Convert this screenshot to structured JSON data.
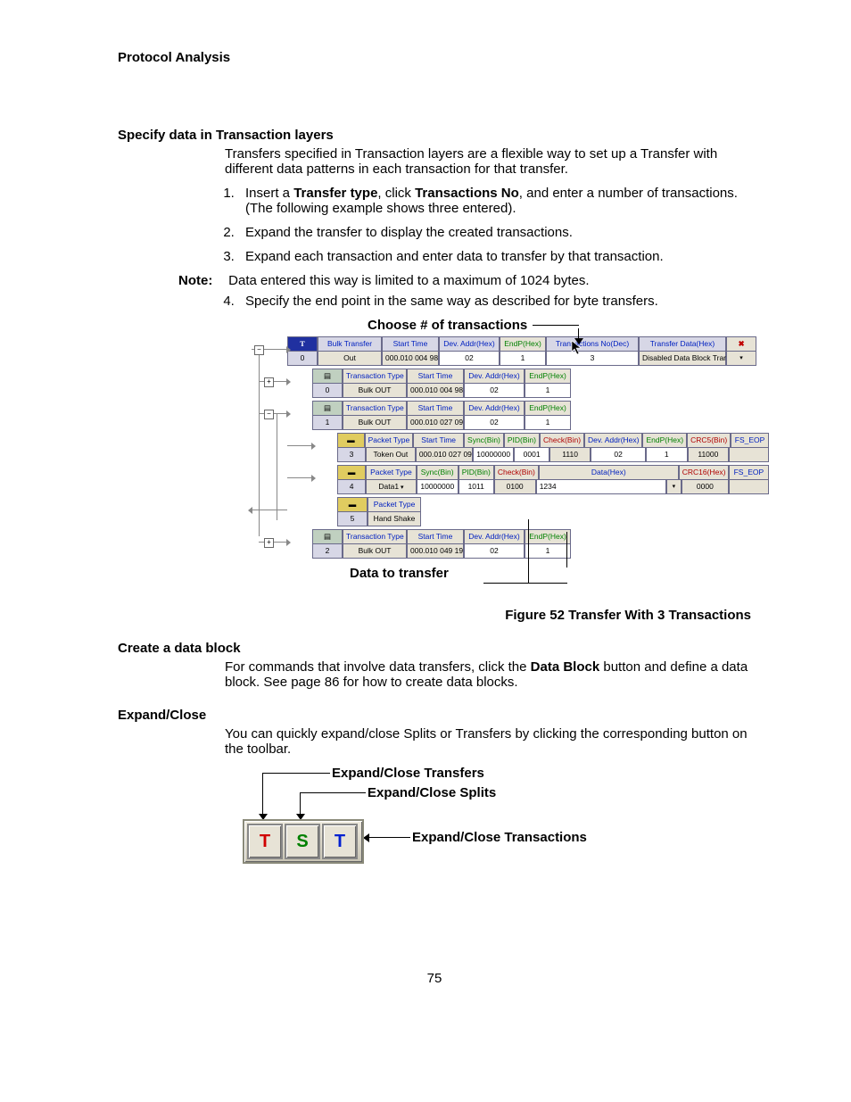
{
  "header": "Protocol Analysis",
  "h_specify": "Specify data in Transaction layers",
  "p_specify": "Transfers specified in Transaction layers are a flexible way to set up a Transfer with different data patterns in each transaction for that transfer.",
  "li1_a": "Insert a ",
  "li1_b": "Transfer type",
  "li1_c": ", click ",
  "li1_d": "Transactions No",
  "li1_e": ", and enter a number of transactions. (The following example shows three entered).",
  "li2": "Expand the transfer to display the created transactions.",
  "li3": "Expand each transaction and enter data to transfer by that transaction.",
  "note_label": "Note:",
  "note_text": "Data entered this way is limited to a maximum of 1024 bytes.",
  "li4": "Specify the end point in the same way as described for byte transfers.",
  "callout_top": "Choose # of transactions",
  "callout_bottom": "Data to transfer",
  "fig_caption": "Figure  52  Transfer With 3 Transactions",
  "h_block": "Create a data block",
  "p_block_a": "For commands that involve data transfers, click the ",
  "p_block_b": "Data Block",
  "p_block_c": " button and define a data block. See page 86 for how to create data blocks.",
  "h_expand": "Expand/Close",
  "p_expand": "You can quickly expand/close Splits or Transfers by clicking the corresponding button on the toolbar.",
  "tb_transfers": "Expand/Close Transfers",
  "tb_splits": "Expand/Close Splits",
  "tb_transactions": "Expand/Close Transactions",
  "pagenum": "75",
  "shot": {
    "r0": {
      "icon": "T",
      "type": "Bulk Transfer",
      "stlabel": "Start Time",
      "st": "000.010 004 98",
      "dalabel": "Dev. Addr(Hex)",
      "da": "02",
      "eplabel": "EndP(Hex)",
      "ep": "1",
      "tnlabel": "Transactions No(Dec)",
      "tn": "3",
      "tdlabel": "Transfer Data(Hex)",
      "td": "Disabled Data Block Transfer",
      "n": "0",
      "dir": "Out"
    },
    "r1": {
      "tlabel": "Transaction Type",
      "stlabel": "Start Time",
      "dalabel": "Dev. Addr(Hex)",
      "eplabel": "EndP(Hex)",
      "n": "0",
      "type": "Bulk OUT",
      "st": "000.010 004 98",
      "da": "02",
      "ep": "1"
    },
    "r2": {
      "n": "1",
      "type": "Bulk OUT",
      "st": "000.010 027 09",
      "da": "02",
      "ep": "1"
    },
    "r3": {
      "plabel": "Packet Type",
      "stlabel": "Start Time",
      "synlabel": "Sync(Bin)",
      "pidlabel": "PID(Bin)",
      "chklabel": "Check(Bin)",
      "dalabel": "Dev. Addr(Hex)",
      "eplabel": "EndP(Hex)",
      "crc5label": "CRC5(Bin)",
      "eoplabel": "FS_EOP",
      "n": "3",
      "type": "Token Out",
      "st": "000.010 027 09",
      "syn": "10000000",
      "pid": "0001",
      "chk": "1110",
      "da": "02",
      "ep": "1",
      "crc5": "11000"
    },
    "r4": {
      "synlabel": "Sync(Bin)",
      "pidlabel": "PID(Bin)",
      "chklabel": "Check(Bin)",
      "datalabel": "Data(Hex)",
      "crc16label": "CRC16(Hex)",
      "eoplabel": "FS_EOP",
      "n": "4",
      "type": "Data1",
      "syn": "10000000",
      "pid": "1011",
      "chk": "0100",
      "data": "1234",
      "crc16": "0000"
    },
    "r5": {
      "n": "5",
      "type": "Hand Shake"
    },
    "r6": {
      "n": "2",
      "type": "Bulk OUT",
      "st": "000.010 049 19",
      "da": "02",
      "ep": "1"
    }
  }
}
